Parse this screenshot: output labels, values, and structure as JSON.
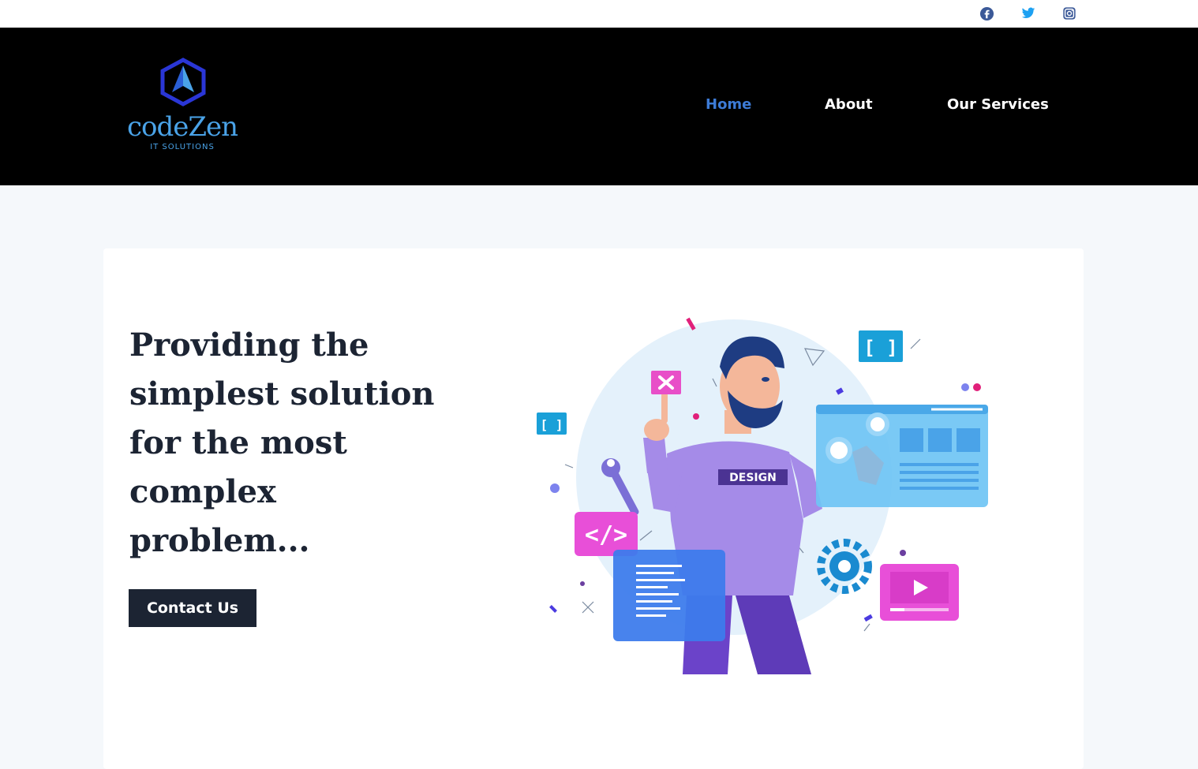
{
  "social": [
    {
      "name": "facebook-icon",
      "color": "#3b5998"
    },
    {
      "name": "twitter-icon",
      "color": "#1da1f2"
    },
    {
      "name": "instagram-icon",
      "color": "#3b5998"
    }
  ],
  "brand": {
    "name": "codeZen",
    "tagline": "IT SOLUTIONS",
    "color": "#4aa3e8"
  },
  "nav": {
    "items": [
      {
        "label": "Home",
        "active": true
      },
      {
        "label": "About",
        "active": false
      },
      {
        "label": "Our Services",
        "active": false
      }
    ],
    "active_color": "#3d7bd6"
  },
  "hero": {
    "title": "Providing the simplest solution for the most complex problem...",
    "cta_label": "Contact Us",
    "illustration": {
      "shirt_label": "DESIGN",
      "code_tag": "</>",
      "brackets": "[ ]"
    }
  }
}
